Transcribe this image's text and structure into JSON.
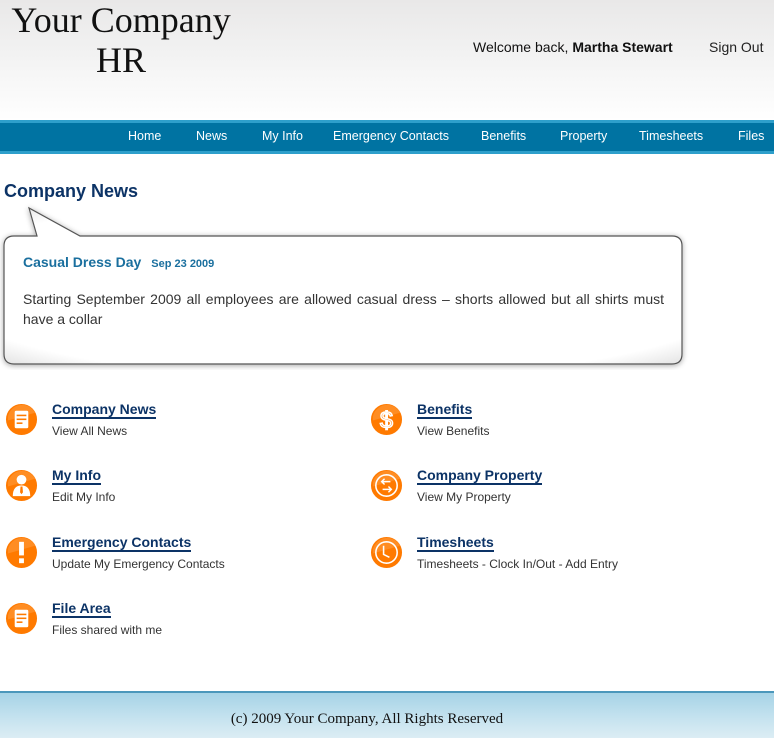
{
  "header": {
    "logo_line1": "Your Company",
    "logo_line2": "HR",
    "welcome_prefix": "Welcome back, ",
    "user_name": "Martha Stewart",
    "signout_label": "Sign Out"
  },
  "nav": {
    "items": [
      {
        "label": "Home"
      },
      {
        "label": "News"
      },
      {
        "label": "My Info"
      },
      {
        "label": "Emergency Contacts"
      },
      {
        "label": "Benefits"
      },
      {
        "label": "Property"
      },
      {
        "label": "Timesheets"
      },
      {
        "label": "Files"
      }
    ]
  },
  "news": {
    "section_title": "Company News",
    "headline": "Casual Dress Day",
    "date": "Sep 23 2009",
    "body": "Starting September 2009 all employees are allowed casual dress – shorts allowed but all shirts must have a collar"
  },
  "quick_links": [
    {
      "title": "Company News",
      "subtitle": "View All News",
      "icon": "document-icon"
    },
    {
      "title": "Benefits",
      "subtitle": "View Benefits",
      "icon": "dollar-icon"
    },
    {
      "title": "My Info",
      "subtitle": "Edit My Info",
      "icon": "person-icon"
    },
    {
      "title": "Company Property",
      "subtitle": "View My Property",
      "icon": "exchange-arrows-icon"
    },
    {
      "title": "Emergency Contacts",
      "subtitle": "Update My Emergency Contacts",
      "icon": "exclamation-icon"
    },
    {
      "title": "Timesheets",
      "subtitle": "Timesheets - Clock In/Out - Add Entry",
      "icon": "clock-icon"
    },
    {
      "title": "File Area",
      "subtitle": "Files shared with me",
      "icon": "document-icon"
    }
  ],
  "colors": {
    "nav_bg": "#0073a2",
    "heading": "#0c3366",
    "news_accent": "#1a6f9e",
    "icon_orange": "#ff7a00"
  },
  "footer": {
    "text": "(c) 2009 Your Company, All Rights Reserved"
  }
}
